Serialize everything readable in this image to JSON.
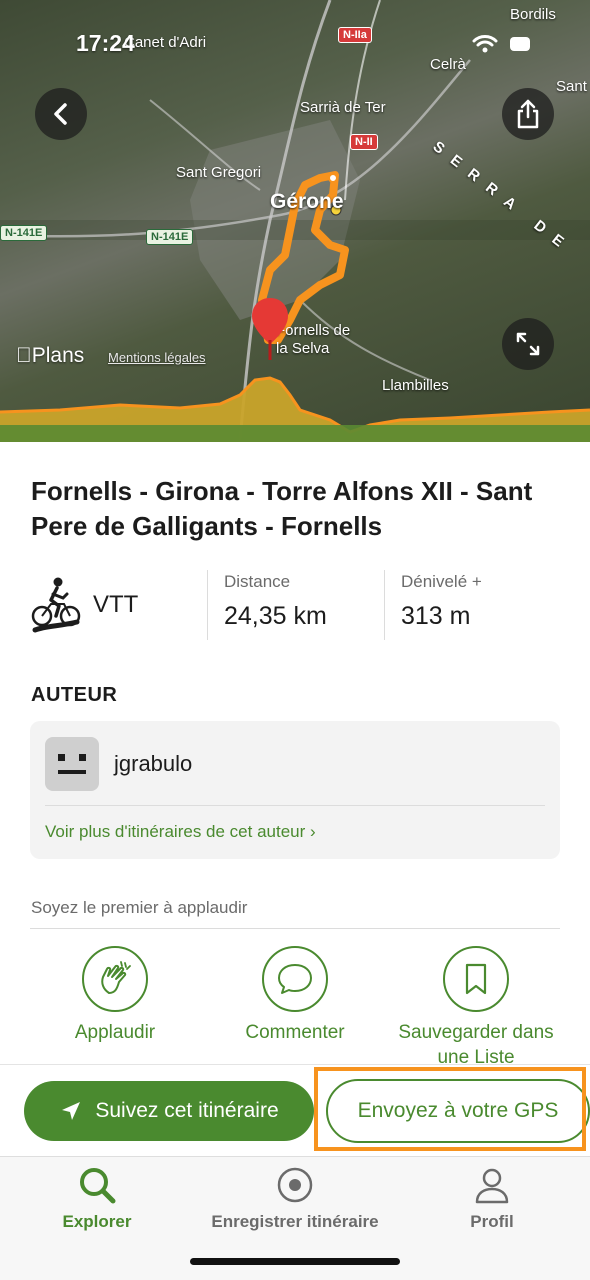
{
  "status_bar": {
    "time": "17:24"
  },
  "map": {
    "attribution_brand": "Plans",
    "legal_link": "Mentions légales",
    "places": {
      "sant_joan": "Sant Joan",
      "bordils": "Bordils",
      "canet": "Canet d'Adri",
      "celra": "Celrà",
      "sant_trailing": "Sant",
      "sarria": "Sarrià de Ter",
      "sant_gregori": "Sant Gregori",
      "girona": "Gérone",
      "serra": "SERRA DE",
      "fornells_1": "Fornells de",
      "fornells_2": "la Selva",
      "llambilles": "Llambilles"
    },
    "roads": [
      "N-IIa",
      "N-II",
      "N-141E",
      "N-141E"
    ],
    "route_color": "#f7931e",
    "pin_color": "#e53935"
  },
  "route": {
    "title": "Fornells - Girona - Torre Alfons XII - Sant Pere de Galligants - Fornells",
    "activity": "VTT",
    "distance_label": "Distance",
    "distance_value": "24,35 km",
    "elevation_label": "Dénivelé +",
    "elevation_value": "313 m"
  },
  "author": {
    "section_title": "AUTEUR",
    "name": "jgrabulo",
    "more_link": "Voir plus d'itinéraires de cet auteur ›"
  },
  "social": {
    "hint": "Soyez le premier à applaudir",
    "actions": [
      {
        "label": "Applaudir",
        "icon": "clap-icon"
      },
      {
        "label": "Commenter",
        "icon": "comment-icon"
      },
      {
        "label": "Sauvegarder dans une Liste",
        "icon": "bookmark-icon"
      }
    ]
  },
  "cta": {
    "follow_label": "Suivez cet itinéraire",
    "gps_label": "Envoyez à votre GPS",
    "highlight_color": "#f7931e"
  },
  "tabbar": {
    "tabs": [
      {
        "label": "Explorer",
        "icon": "search-icon",
        "active": true
      },
      {
        "label": "Enregistrer itinéraire",
        "icon": "record-icon",
        "active": false
      },
      {
        "label": "Profil",
        "icon": "profile-icon",
        "active": false
      }
    ]
  },
  "colors": {
    "accent": "#4a8a2f",
    "text": "#1c1c1c",
    "muted": "#6b6b6b"
  }
}
